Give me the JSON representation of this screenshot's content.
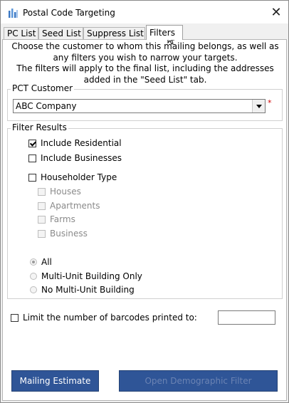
{
  "window": {
    "title": "Postal Code Targeting",
    "close_glyph": "✕",
    "icon": "app-bars-icon"
  },
  "tabs": [
    {
      "label": "PC List",
      "active": false
    },
    {
      "label": "Seed List",
      "active": false
    },
    {
      "label": "Suppress List",
      "active": false
    },
    {
      "label": "Filters",
      "active": true
    }
  ],
  "info": {
    "line1": "Choose the customer to whom this mailing belongs, as well as",
    "line2": "any filters you wish to narrow your targets.",
    "line3": "The filters will apply to the final list, including the addresses",
    "line4": "added in the \"Seed List\" tab."
  },
  "customer": {
    "group_title": "PCT Customer",
    "selected": "ABC Company",
    "required_mark": "*"
  },
  "filters": {
    "group_title": "Filter Results",
    "include_residential": {
      "label": "Include Residential",
      "checked": true
    },
    "include_businesses": {
      "label": "Include Businesses",
      "checked": false
    },
    "householder_type": {
      "label": "Householder Type",
      "checked": false
    },
    "sub_types": [
      {
        "label": "Houses"
      },
      {
        "label": "Apartments"
      },
      {
        "label": "Farms"
      },
      {
        "label": "Business"
      }
    ],
    "unit_options": [
      {
        "label": "All",
        "selected": true
      },
      {
        "label": "Multi-Unit Building Only",
        "selected": false
      },
      {
        "label": "No Multi-Unit Building",
        "selected": false
      }
    ]
  },
  "limit": {
    "label": "Limit the number of barcodes printed to:",
    "checked": false,
    "value": ""
  },
  "buttons": {
    "mailing_estimate": "Mailing Estimate",
    "open_demographic_filter": "Open Demographic Filter"
  },
  "colors": {
    "button_bg": "#2f5597",
    "button_disabled_text": "#6b83b3",
    "required": "#d00000"
  }
}
